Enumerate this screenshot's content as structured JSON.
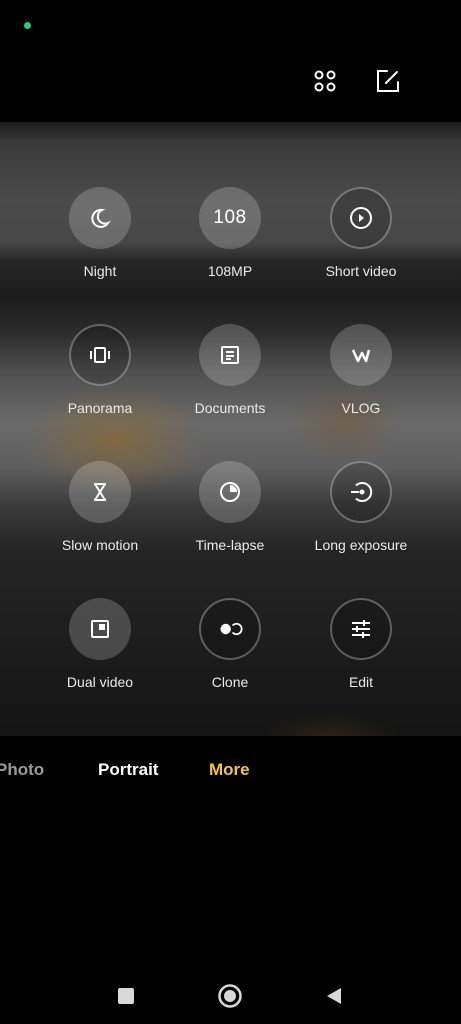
{
  "colors": {
    "status_dot": "#2ecc71",
    "accent": "#f5c542",
    "text": "#eaeaea",
    "background": "#000000"
  },
  "top_bar": {
    "icons": [
      "grid-icon",
      "edit-icon"
    ]
  },
  "modes": [
    {
      "label": "Night",
      "icon": "moon-icon"
    },
    {
      "label": "108MP",
      "icon_text": "108"
    },
    {
      "label": "Short video",
      "icon": "play-circle-icon"
    },
    {
      "label": "Panorama",
      "icon": "panorama-icon"
    },
    {
      "label": "Documents",
      "icon": "document-icon"
    },
    {
      "label": "VLOG",
      "icon": "vlog-icon"
    },
    {
      "label": "Slow motion",
      "icon": "hourglass-icon"
    },
    {
      "label": "Time-lapse",
      "icon": "timelapse-icon"
    },
    {
      "label": "Long exposure",
      "icon": "long-exposure-icon"
    },
    {
      "label": "Dual video",
      "icon": "dual-video-icon"
    },
    {
      "label": "Clone",
      "icon": "clone-icon"
    },
    {
      "label": "Edit",
      "icon": "sliders-icon"
    }
  ],
  "mode_bar": {
    "items": [
      "Photo",
      "Portrait",
      "More"
    ],
    "active": "More"
  },
  "nav_bar": {
    "icons": [
      "recents-icon",
      "home-icon",
      "back-icon"
    ]
  }
}
